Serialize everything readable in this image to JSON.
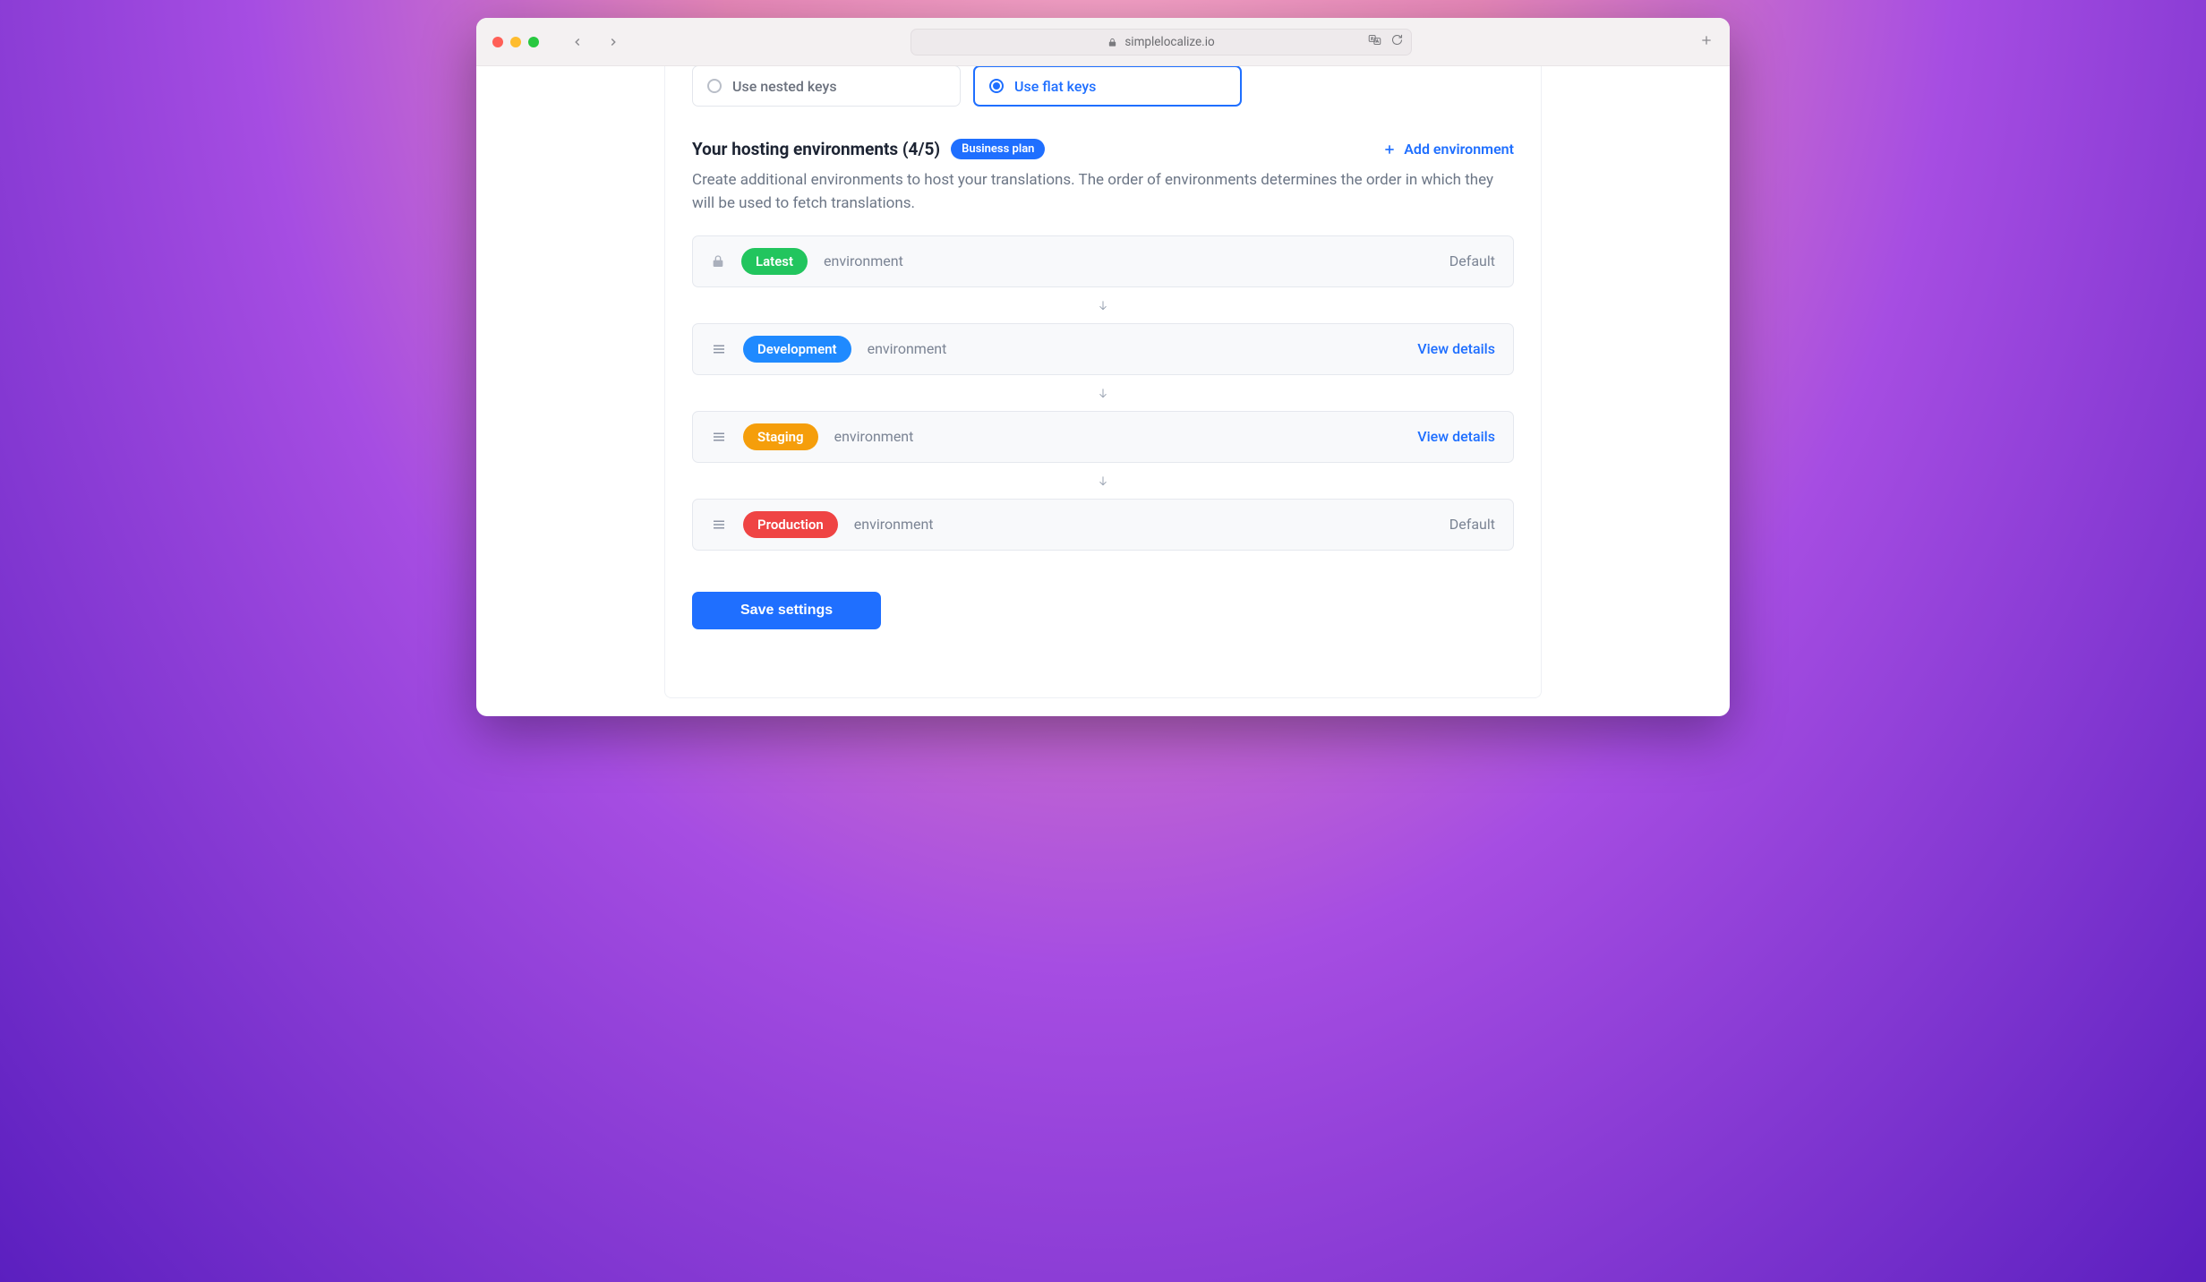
{
  "browser": {
    "url": "simplelocalize.io"
  },
  "keyOptions": {
    "nested": {
      "label": "Use nested keys",
      "selected": false
    },
    "flat": {
      "label": "Use flat keys",
      "selected": true
    }
  },
  "section": {
    "title": "Your hosting environments (4/5)",
    "planBadge": "Business plan",
    "addLabel": "Add environment",
    "description": "Create additional environments to host your translations. The order of environments determines the order in which they will be used to fetch translations."
  },
  "environments": [
    {
      "name": "Latest",
      "pillColor": "green",
      "locked": true,
      "label": "environment",
      "action": "Default",
      "actionLink": false
    },
    {
      "name": "Development",
      "pillColor": "blue",
      "locked": false,
      "label": "environment",
      "action": "View details",
      "actionLink": true
    },
    {
      "name": "Staging",
      "pillColor": "orange",
      "locked": false,
      "label": "environment",
      "action": "View details",
      "actionLink": true
    },
    {
      "name": "Production",
      "pillColor": "red",
      "locked": false,
      "label": "environment",
      "action": "Default",
      "actionLink": false
    }
  ],
  "saveButton": "Save settings"
}
